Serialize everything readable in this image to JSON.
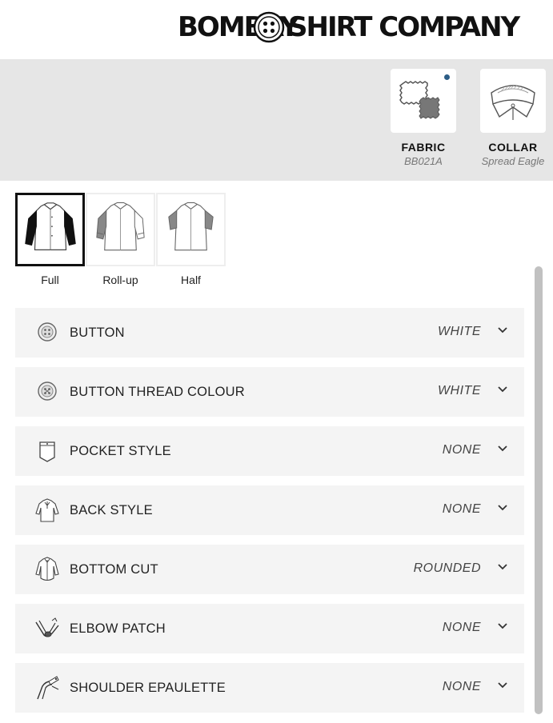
{
  "brand": {
    "left": "BOMBAY",
    "right": "SHIRT COMPANY"
  },
  "options": [
    {
      "title": "FABRIC",
      "value": "BB021A",
      "icon": "fabric-swatch-icon"
    },
    {
      "title": "COLLAR",
      "value": "Spread Eagle",
      "icon": "collar-icon"
    }
  ],
  "sleeves": [
    {
      "label": "Full",
      "selected": true
    },
    {
      "label": "Roll-up",
      "selected": false
    },
    {
      "label": "Half",
      "selected": false
    }
  ],
  "customizations": [
    {
      "label": "BUTTON",
      "value": "WHITE",
      "icon": "button-icon"
    },
    {
      "label": "BUTTON THREAD COLOUR",
      "value": "WHITE",
      "icon": "button-icon"
    },
    {
      "label": "POCKET STYLE",
      "value": "NONE",
      "icon": "pocket-icon"
    },
    {
      "label": "BACK STYLE",
      "value": "NONE",
      "icon": "shirt-back-icon"
    },
    {
      "label": "BOTTOM CUT",
      "value": "ROUNDED",
      "icon": "shirt-bottom-icon"
    },
    {
      "label": "ELBOW PATCH",
      "value": "NONE",
      "icon": "elbow-patch-icon"
    },
    {
      "label": "SHOULDER EPAULETTE",
      "value": "NONE",
      "icon": "epaulette-icon"
    }
  ],
  "colors": {
    "panel": "#e6e6e6",
    "row": "#f4f4f4",
    "dot": "#2c5d86",
    "selected_border": "#111111"
  }
}
